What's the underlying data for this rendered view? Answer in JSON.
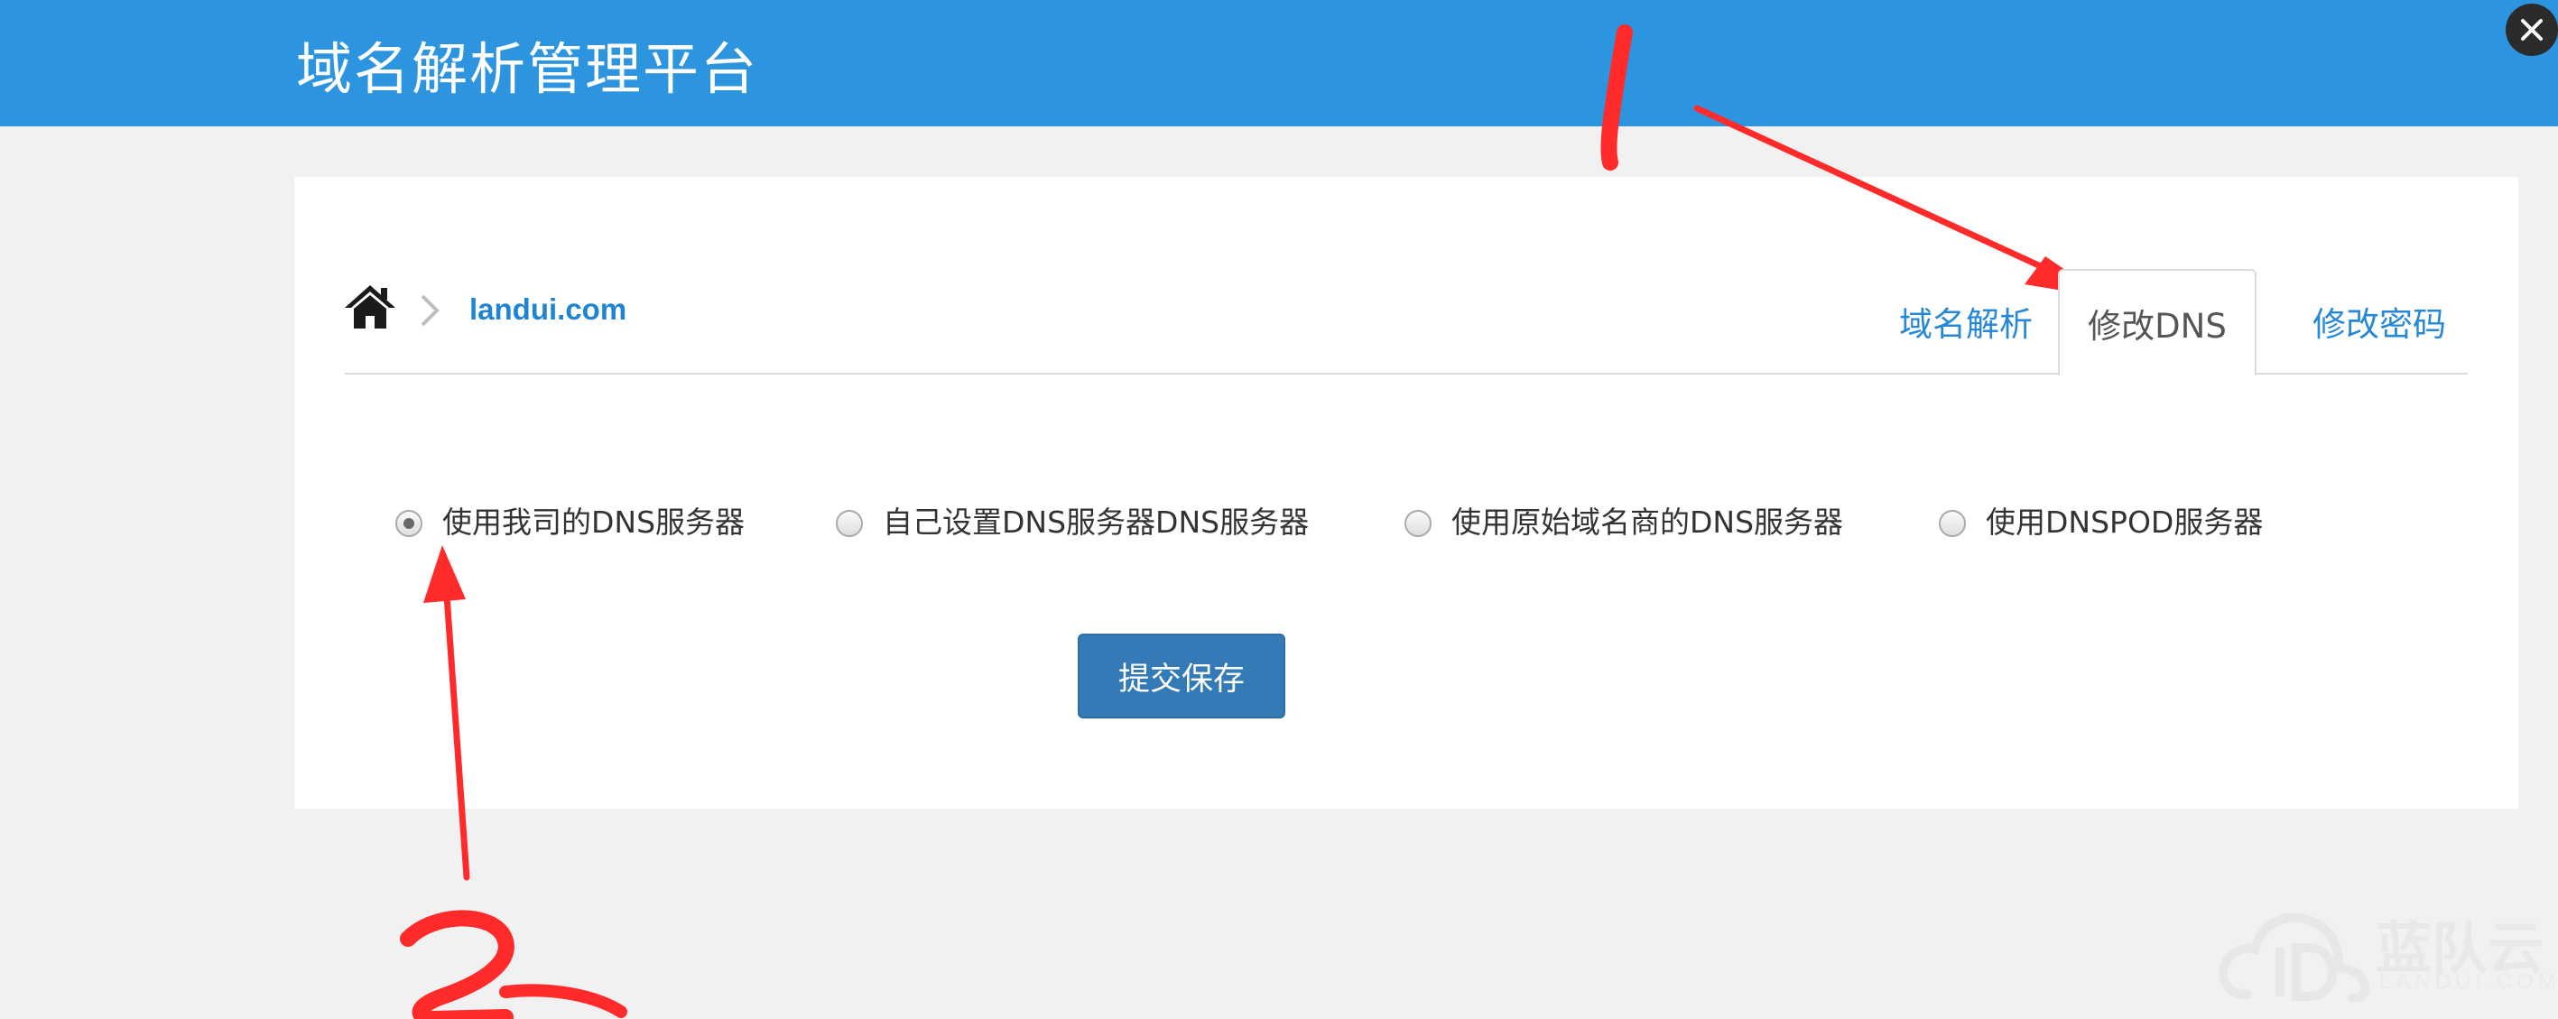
{
  "header": {
    "title": "域名解析管理平台",
    "background_color": "#2d94e0"
  },
  "close_button": {
    "icon": "close-icon"
  },
  "breadcrumb": {
    "home_icon": "home-icon",
    "separator_icon": "chevron-right-icon",
    "domain": "landui.com"
  },
  "tabs": [
    {
      "label": "域名解析",
      "active": false
    },
    {
      "label": "修改DNS",
      "active": true
    },
    {
      "label": "修改密码",
      "active": false
    }
  ],
  "dns_options": [
    {
      "label": "使用我司的DNS服务器",
      "checked": true
    },
    {
      "label": "自己设置DNS服务器DNS服务器",
      "checked": false
    },
    {
      "label": "使用原始域名商的DNS服务器",
      "checked": false
    },
    {
      "label": "使用DNSPOD服务器",
      "checked": false
    }
  ],
  "submit_label": "提交保存",
  "annotations": {
    "color": "#ff2a2a",
    "marks": [
      "1",
      "2"
    ]
  },
  "watermark": {
    "text": "蓝队云",
    "subtext": "LANDUI.COM",
    "icon": "cloud-logo-icon"
  },
  "colors": {
    "link": "#1f85d3",
    "primary_button": "#337ab7",
    "page_background": "#f1f1f1"
  }
}
